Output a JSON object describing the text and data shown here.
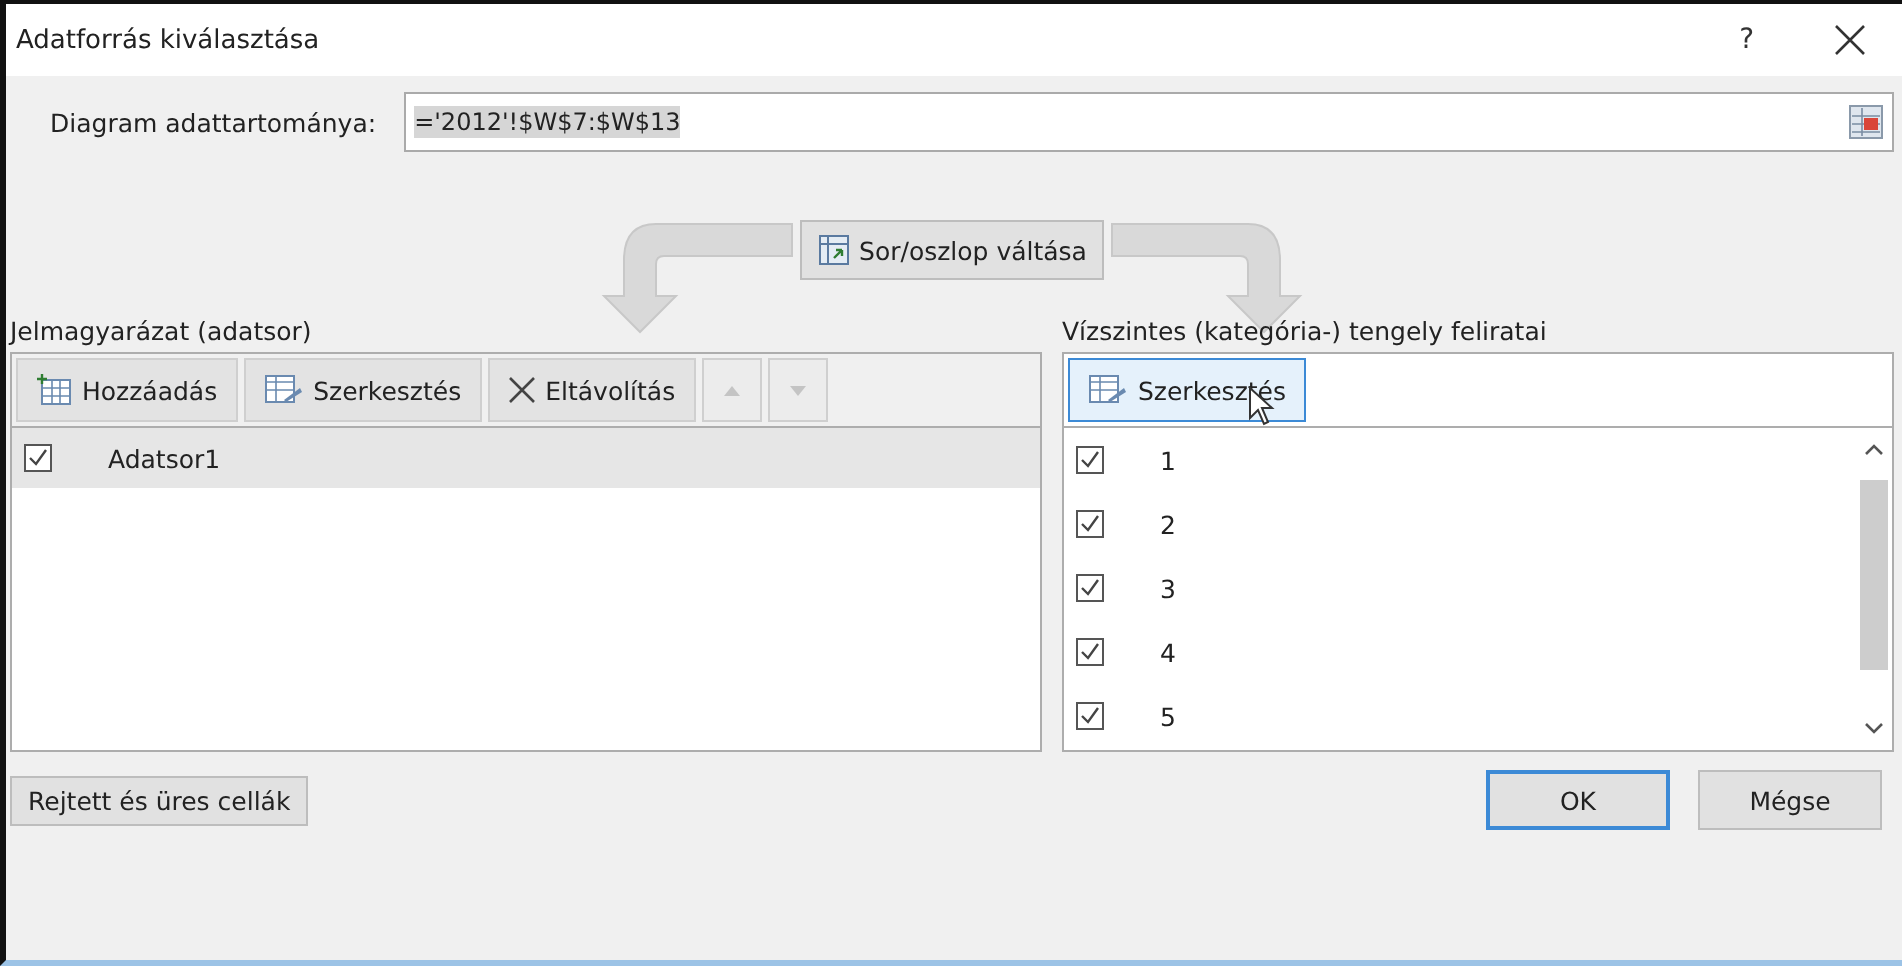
{
  "window": {
    "title": "Adatforrás kiválasztása",
    "help": "?"
  },
  "range": {
    "label": "Diagram adattartománya:",
    "value": "='2012'!$W$7:$W$13"
  },
  "switch_button": "Sor/oszlop váltása",
  "legend": {
    "title": "Jelmagyarázat (adatsor)",
    "toolbar": [
      {
        "kind": "add",
        "label": "Hozzáadás",
        "disabled": false
      },
      {
        "kind": "edit",
        "label": "Szerkesztés",
        "disabled": false
      },
      {
        "kind": "remove",
        "label": "Eltávolítás",
        "disabled": false
      },
      {
        "kind": "up",
        "disabled": true
      },
      {
        "kind": "down",
        "disabled": true
      }
    ],
    "items": [
      {
        "label": "Adatsor1",
        "checked": true,
        "selected": true
      }
    ]
  },
  "axis": {
    "title": "Vízszintes (kategória-) tengely feliratai",
    "toolbar": [
      {
        "kind": "edit",
        "label": "Szerkesztés",
        "hovered": true
      }
    ],
    "items": [
      {
        "label": "1",
        "checked": true
      },
      {
        "label": "2",
        "checked": true
      },
      {
        "label": "3",
        "checked": true
      },
      {
        "label": "4",
        "checked": true
      },
      {
        "label": "5",
        "checked": true
      }
    ]
  },
  "hidden_cells_button": "Rejtett és üres cellák",
  "buttons": [
    {
      "label": "OK",
      "default": true
    },
    {
      "label": "Mégse",
      "default": false
    }
  ]
}
